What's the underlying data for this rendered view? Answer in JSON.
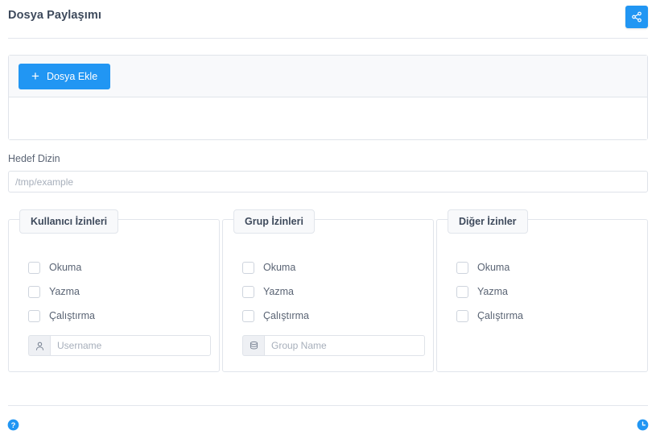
{
  "header": {
    "title": "Dosya Paylaşımı",
    "share_button_icon": "share-icon"
  },
  "file_card": {
    "add_button_label": "Dosya Ekle",
    "add_button_icon": "plus-icon",
    "file_list_items": []
  },
  "target_directory": {
    "label": "Hedef Dizin",
    "value": "",
    "placeholder": "/tmp/example"
  },
  "permissions": {
    "panels": [
      {
        "legend": "Kullanıcı İzinleri",
        "checkboxes": [
          {
            "label": "Okuma",
            "checked": false
          },
          {
            "label": "Yazma",
            "checked": false
          },
          {
            "label": "Çalıştırma",
            "checked": false
          }
        ],
        "input": {
          "icon": "user-icon",
          "placeholder": "Username",
          "value": ""
        }
      },
      {
        "legend": "Grup İzinleri",
        "checkboxes": [
          {
            "label": "Okuma",
            "checked": false
          },
          {
            "label": "Yazma",
            "checked": false
          },
          {
            "label": "Çalıştırma",
            "checked": false
          }
        ],
        "input": {
          "icon": "group-stack-icon",
          "placeholder": "Group Name",
          "value": ""
        }
      },
      {
        "legend": "Diğer İzinler",
        "checkboxes": [
          {
            "label": "Okuma",
            "checked": false
          },
          {
            "label": "Yazma",
            "checked": false
          },
          {
            "label": "Çalıştırma",
            "checked": false
          }
        ],
        "input": null
      }
    ]
  },
  "footer": {
    "help_icon": "help-circle-icon",
    "history_icon": "clock-circle-icon"
  },
  "colors": {
    "accent": "#2196f3",
    "border": "#e1e5eb",
    "text": "#4a5464",
    "heading": "#3e4a5c",
    "panel_bg": "#f8f9fb",
    "placeholder": "#a7afbb"
  }
}
